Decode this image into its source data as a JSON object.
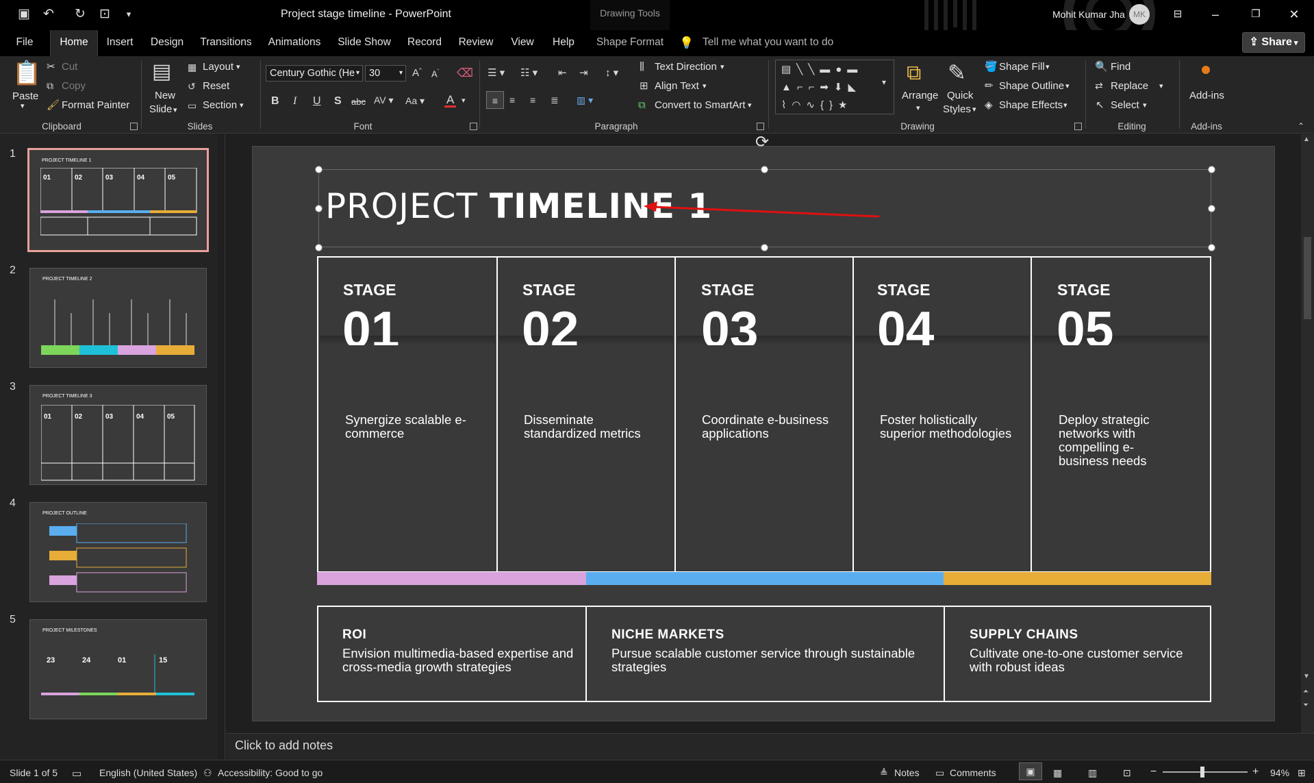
{
  "titlebar": {
    "title": "Project stage timeline  -  PowerPoint",
    "drawing_tools": "Drawing Tools",
    "user": "Mohit Kumar Jha",
    "avatar": "MK"
  },
  "tabs": [
    "File",
    "Home",
    "Insert",
    "Design",
    "Transitions",
    "Animations",
    "Slide Show",
    "Record",
    "Review",
    "View",
    "Help",
    "Shape Format"
  ],
  "tellme": "Tell me what you want to do",
  "share": "Share",
  "ribbon": {
    "clipboard": {
      "paste": "Paste",
      "cut": "Cut",
      "copy": "Copy",
      "format_painter": "Format Painter",
      "label": "Clipboard"
    },
    "slides": {
      "new_slide_1": "New",
      "new_slide_2": "Slide",
      "layout": "Layout",
      "reset": "Reset",
      "section": "Section",
      "label": "Slides"
    },
    "font": {
      "name": "Century Gothic (He",
      "size": "30",
      "label": "Font"
    },
    "paragraph": {
      "text_direction": "Text Direction",
      "align_text": "Align Text",
      "convert": "Convert to SmartArt",
      "label": "Paragraph"
    },
    "drawing": {
      "arrange": "Arrange",
      "quick1": "Quick",
      "quick2": "Styles",
      "fill": "Shape Fill",
      "outline": "Shape Outline",
      "effects": "Shape Effects",
      "label": "Drawing"
    },
    "editing": {
      "find": "Find",
      "replace": "Replace",
      "select": "Select",
      "label": "Editing"
    },
    "addins": {
      "btn": "Add-ins",
      "label": "Add-ins"
    }
  },
  "thumbnails": [
    {
      "num": "1",
      "title": "PROJECT TIMELINE 1"
    },
    {
      "num": "2",
      "title": "PROJECT TIMELINE 2"
    },
    {
      "num": "3",
      "title": "PROJECT TIMELINE 3"
    },
    {
      "num": "4",
      "title": "PROJECT OUTLINE"
    },
    {
      "num": "5",
      "title": "PROJECT MILESTONES"
    }
  ],
  "slide": {
    "title_light": "PROJECT ",
    "title_bold": "TIMELINE 1",
    "stage_label": "STAGE",
    "stages": [
      {
        "num": "01",
        "desc": "Synergize scalable e-commerce"
      },
      {
        "num": "02",
        "desc": "Disseminate standardized metrics"
      },
      {
        "num": "03",
        "desc": "Coordinate e-business applications"
      },
      {
        "num": "04",
        "desc": "Foster holistically superior methodologies"
      },
      {
        "num": "05",
        "desc": "Deploy strategic networks with compelling e-business needs"
      }
    ],
    "bar_colors": [
      "#d9a3dd",
      "#5aaef0",
      "#e8ad38"
    ],
    "bottom": [
      {
        "head": "ROI",
        "body": "Envision multimedia-based expertise and cross-media growth strategies"
      },
      {
        "head": "NICHE MARKETS",
        "body": "Pursue scalable customer service through sustainable strategies"
      },
      {
        "head": "SUPPLY CHAINS",
        "body": "Cultivate one-to-one customer service with robust ideas"
      }
    ]
  },
  "notes": "Click to add notes",
  "status": {
    "slide": "Slide 1 of 5",
    "language": "English (United States)",
    "accessibility": "Accessibility: Good to go",
    "notes": "Notes",
    "comments": "Comments",
    "zoom": "94%"
  }
}
